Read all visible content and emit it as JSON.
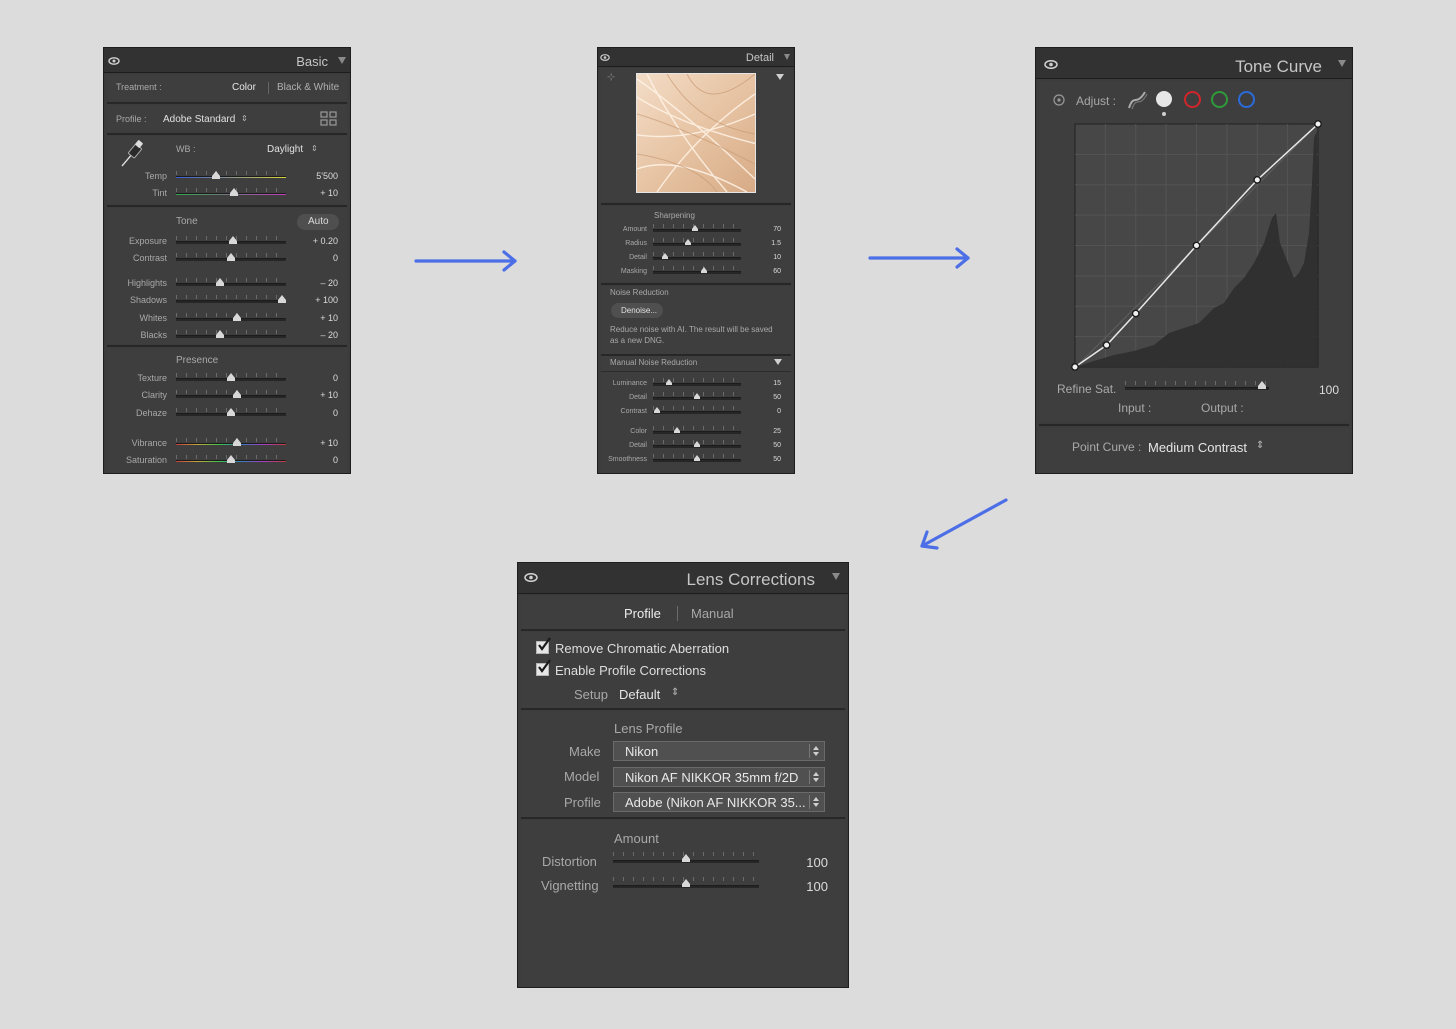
{
  "basic": {
    "title": "Basic",
    "treatment_label": "Treatment :",
    "treatment_color": "Color",
    "treatment_bw": "Black & White",
    "profile_label": "Profile :",
    "profile_value": "Adobe Standard",
    "wb_label": "WB :",
    "wb_value": "Daylight",
    "tone_label": "Tone",
    "auto_label": "Auto",
    "presence_label": "Presence",
    "sliders": [
      {
        "label": "Temp",
        "value": "5'500",
        "pos": 0.36,
        "gradient": "temp"
      },
      {
        "label": "Tint",
        "value": "+ 10",
        "pos": 0.53,
        "gradient": "tint"
      },
      {
        "label": "Exposure",
        "value": "+ 0.20",
        "pos": 0.52
      },
      {
        "label": "Contrast",
        "value": "0",
        "pos": 0.5
      },
      {
        "label": "Highlights",
        "value": "– 20",
        "pos": 0.4
      },
      {
        "label": "Shadows",
        "value": "+ 100",
        "pos": 0.96
      },
      {
        "label": "Whites",
        "value": "+ 10",
        "pos": 0.55
      },
      {
        "label": "Blacks",
        "value": "– 20",
        "pos": 0.4
      },
      {
        "label": "Texture",
        "value": "0",
        "pos": 0.5
      },
      {
        "label": "Clarity",
        "value": "+ 10",
        "pos": 0.55
      },
      {
        "label": "Dehaze",
        "value": "0",
        "pos": 0.5
      },
      {
        "label": "Vibrance",
        "value": "+ 10",
        "pos": 0.55,
        "gradient": "vib"
      },
      {
        "label": "Saturation",
        "value": "0",
        "pos": 0.5,
        "gradient": "vib"
      }
    ]
  },
  "detail": {
    "title": "Detail",
    "sharpening_label": "Sharpening",
    "sharpening": [
      {
        "label": "Amount",
        "value": "70",
        "pos": 0.48
      },
      {
        "label": "Radius",
        "value": "1.5",
        "pos": 0.4
      },
      {
        "label": "Detail",
        "value": "10",
        "pos": 0.14
      },
      {
        "label": "Masking",
        "value": "60",
        "pos": 0.58
      }
    ],
    "noise_label": "Noise Reduction",
    "denoise_button": "Denoise...",
    "denoise_note_1": "Reduce noise with AI. The result will be saved",
    "denoise_note_2": "as a new DNG.",
    "manual_label": "Manual Noise Reduction",
    "manual": [
      {
        "label": "Luminance",
        "value": "15",
        "pos": 0.18
      },
      {
        "label": "Detail",
        "value": "50",
        "pos": 0.5
      },
      {
        "label": "Contrast",
        "value": "0",
        "pos": 0.05
      },
      {
        "label": "Color",
        "value": "25",
        "pos": 0.27
      },
      {
        "label": "Detail",
        "value": "50",
        "pos": 0.5
      },
      {
        "label": "Smoothness",
        "value": "50",
        "pos": 0.5
      }
    ]
  },
  "tone_curve": {
    "title": "Tone Curve",
    "adjust_label": "Adjust :",
    "refine_label": "Refine Sat.",
    "refine_value": "100",
    "refine_pos": 0.95,
    "input_label": "Input :",
    "output_label": "Output :",
    "point_curve_label": "Point Curve :",
    "point_curve_value": "Medium Contrast",
    "channel_colors": {
      "red": "#d0262b",
      "green": "#2e9a3a",
      "blue": "#2a6bd8"
    },
    "curve_points": [
      [
        0,
        0
      ],
      [
        0.13,
        0.09
      ],
      [
        0.25,
        0.22
      ],
      [
        0.5,
        0.5
      ],
      [
        0.75,
        0.77
      ],
      [
        1,
        1
      ]
    ]
  },
  "lens": {
    "title": "Lens Corrections",
    "tab_profile": "Profile",
    "tab_manual": "Manual",
    "remove_ca": "Remove Chromatic Aberration",
    "enable_profile": "Enable Profile Corrections",
    "setup_label": "Setup",
    "setup_value": "Default",
    "lens_profile_label": "Lens Profile",
    "make_label": "Make",
    "make_value": "Nikon",
    "model_label": "Model",
    "model_value": "Nikon AF NIKKOR 35mm f/2D",
    "profile_label": "Profile",
    "profile_value": "Adobe (Nikon AF NIKKOR 35...",
    "amount_label": "Amount",
    "distortion_label": "Distortion",
    "distortion_value": "100",
    "distortion_pos": 0.5,
    "vignetting_label": "Vignetting",
    "vignetting_value": "100",
    "vignetting_pos": 0.5
  },
  "colors": {
    "arrow": "#4c6ee6",
    "panel": "#3c3c3c",
    "background": "#dcdcdc"
  }
}
